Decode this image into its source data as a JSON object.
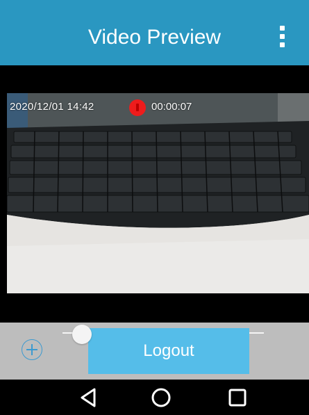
{
  "header": {
    "title": "Video Preview",
    "menu_icon": "overflow-menu-icon",
    "background_color": "#2a97c1"
  },
  "video": {
    "osd_timestamp": "2020/12/01 14:42",
    "recording_indicator": "record-icon",
    "recording_color": "#ee1c1c",
    "osd_duration": "00:00:07"
  },
  "controls": {
    "zoom_icon": "zoom-in-icon",
    "zoom_slider_level": 0.08,
    "logout_label": "Logout",
    "accent_color": "#55bde9"
  },
  "nav_bar": {
    "back_icon": "back-triangle-icon",
    "home_icon": "home-circle-icon",
    "recents_icon": "recents-square-icon"
  }
}
